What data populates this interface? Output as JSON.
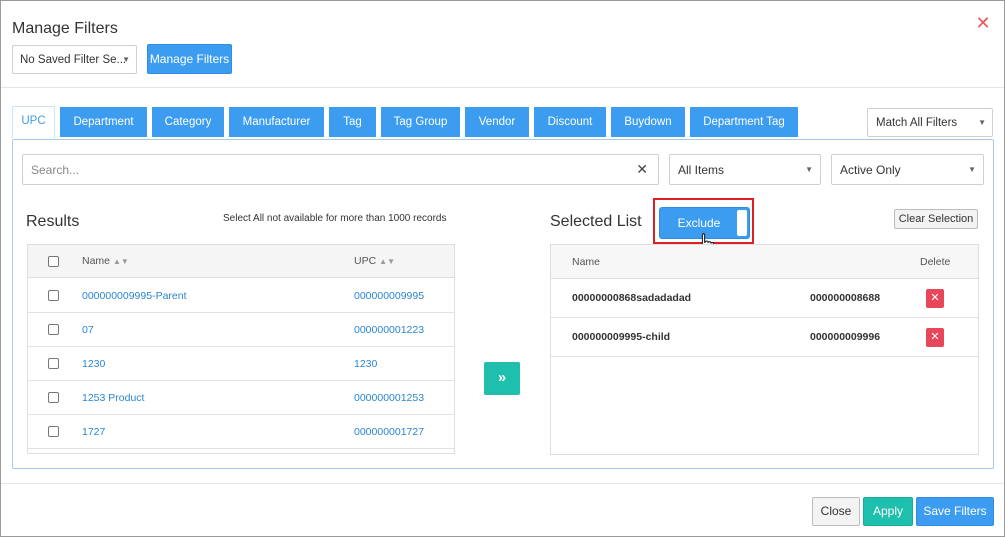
{
  "dialog": {
    "title": "Manage Filters",
    "close_icon": "close-icon"
  },
  "toolbar": {
    "saved_filter_value": "No Saved Filter Se...",
    "manage_filters_label": "Manage Filters"
  },
  "tabs": [
    {
      "label": "UPC",
      "active": true
    },
    {
      "label": "Department"
    },
    {
      "label": "Category"
    },
    {
      "label": "Manufacturer"
    },
    {
      "label": "Tag"
    },
    {
      "label": "Tag Group"
    },
    {
      "label": "Vendor"
    },
    {
      "label": "Discount"
    },
    {
      "label": "Buydown"
    },
    {
      "label": "Department Tag"
    }
  ],
  "match_select": {
    "value": "Match All Filters"
  },
  "search": {
    "placeholder": "Search...",
    "items_filter": "All Items",
    "status_filter": "Active Only"
  },
  "results": {
    "title": "Results",
    "note": "Select All not available for more than 1000 records",
    "columns": {
      "name": "Name",
      "upc": "UPC"
    },
    "rows": [
      {
        "name": "000000009995-Parent",
        "upc": "000000009995"
      },
      {
        "name": "07",
        "upc": "000000001223"
      },
      {
        "name": "1230",
        "upc": "1230"
      },
      {
        "name": "1253 Product",
        "upc": "000000001253"
      },
      {
        "name": "1727",
        "upc": "000000001727"
      }
    ]
  },
  "selected": {
    "title": "Selected List",
    "exclude_label": "Exclude",
    "clear_label": "Clear Selection",
    "columns": {
      "name": "Name",
      "delete": "Delete"
    },
    "rows": [
      {
        "name": "00000000868sadadadad",
        "upc": "000000008688"
      },
      {
        "name": "000000009995-child",
        "upc": "000000009996"
      }
    ]
  },
  "footer": {
    "close_label": "Close",
    "apply_label": "Apply",
    "save_label": "Save Filters"
  },
  "colors": {
    "primary": "#3c9df0",
    "teal": "#1fbfad",
    "danger": "#e8475b",
    "highlight": "#e02020",
    "link": "#2a86d1"
  }
}
